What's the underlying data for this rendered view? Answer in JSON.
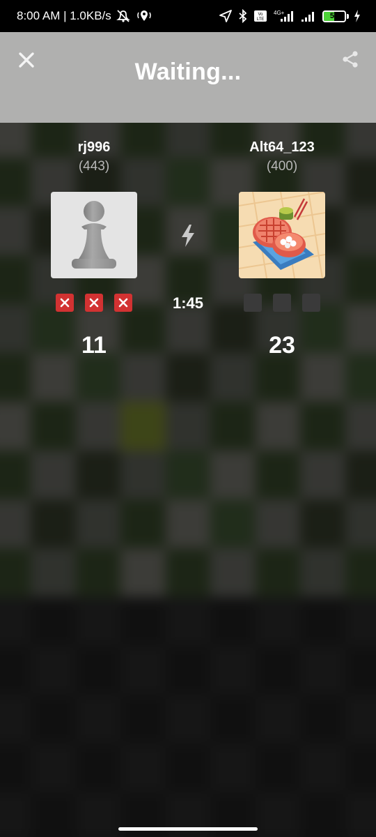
{
  "status_bar": {
    "time_speed": "8:00 AM | 1.0KB/s",
    "battery": "50",
    "network": "4G+",
    "volte": "Vo LTE"
  },
  "header": {
    "title": "Waiting..."
  },
  "players": {
    "left": {
      "name": "rj996",
      "rating": "(443)",
      "avatar": "pawn-icon",
      "score": "11",
      "marks": [
        "loss",
        "loss",
        "loss"
      ]
    },
    "right": {
      "name": "Alt64_123",
      "rating": "(400)",
      "avatar": "grill-picture",
      "score": "23",
      "marks": [
        "empty",
        "empty",
        "empty"
      ]
    }
  },
  "match": {
    "time_control_icon": "lightning-bolt-icon",
    "timer": "1:45"
  },
  "colors": {
    "header_bg": "#b0b0af",
    "loss_mark": "#d23232",
    "empty_mark": "#3a3a3a"
  }
}
